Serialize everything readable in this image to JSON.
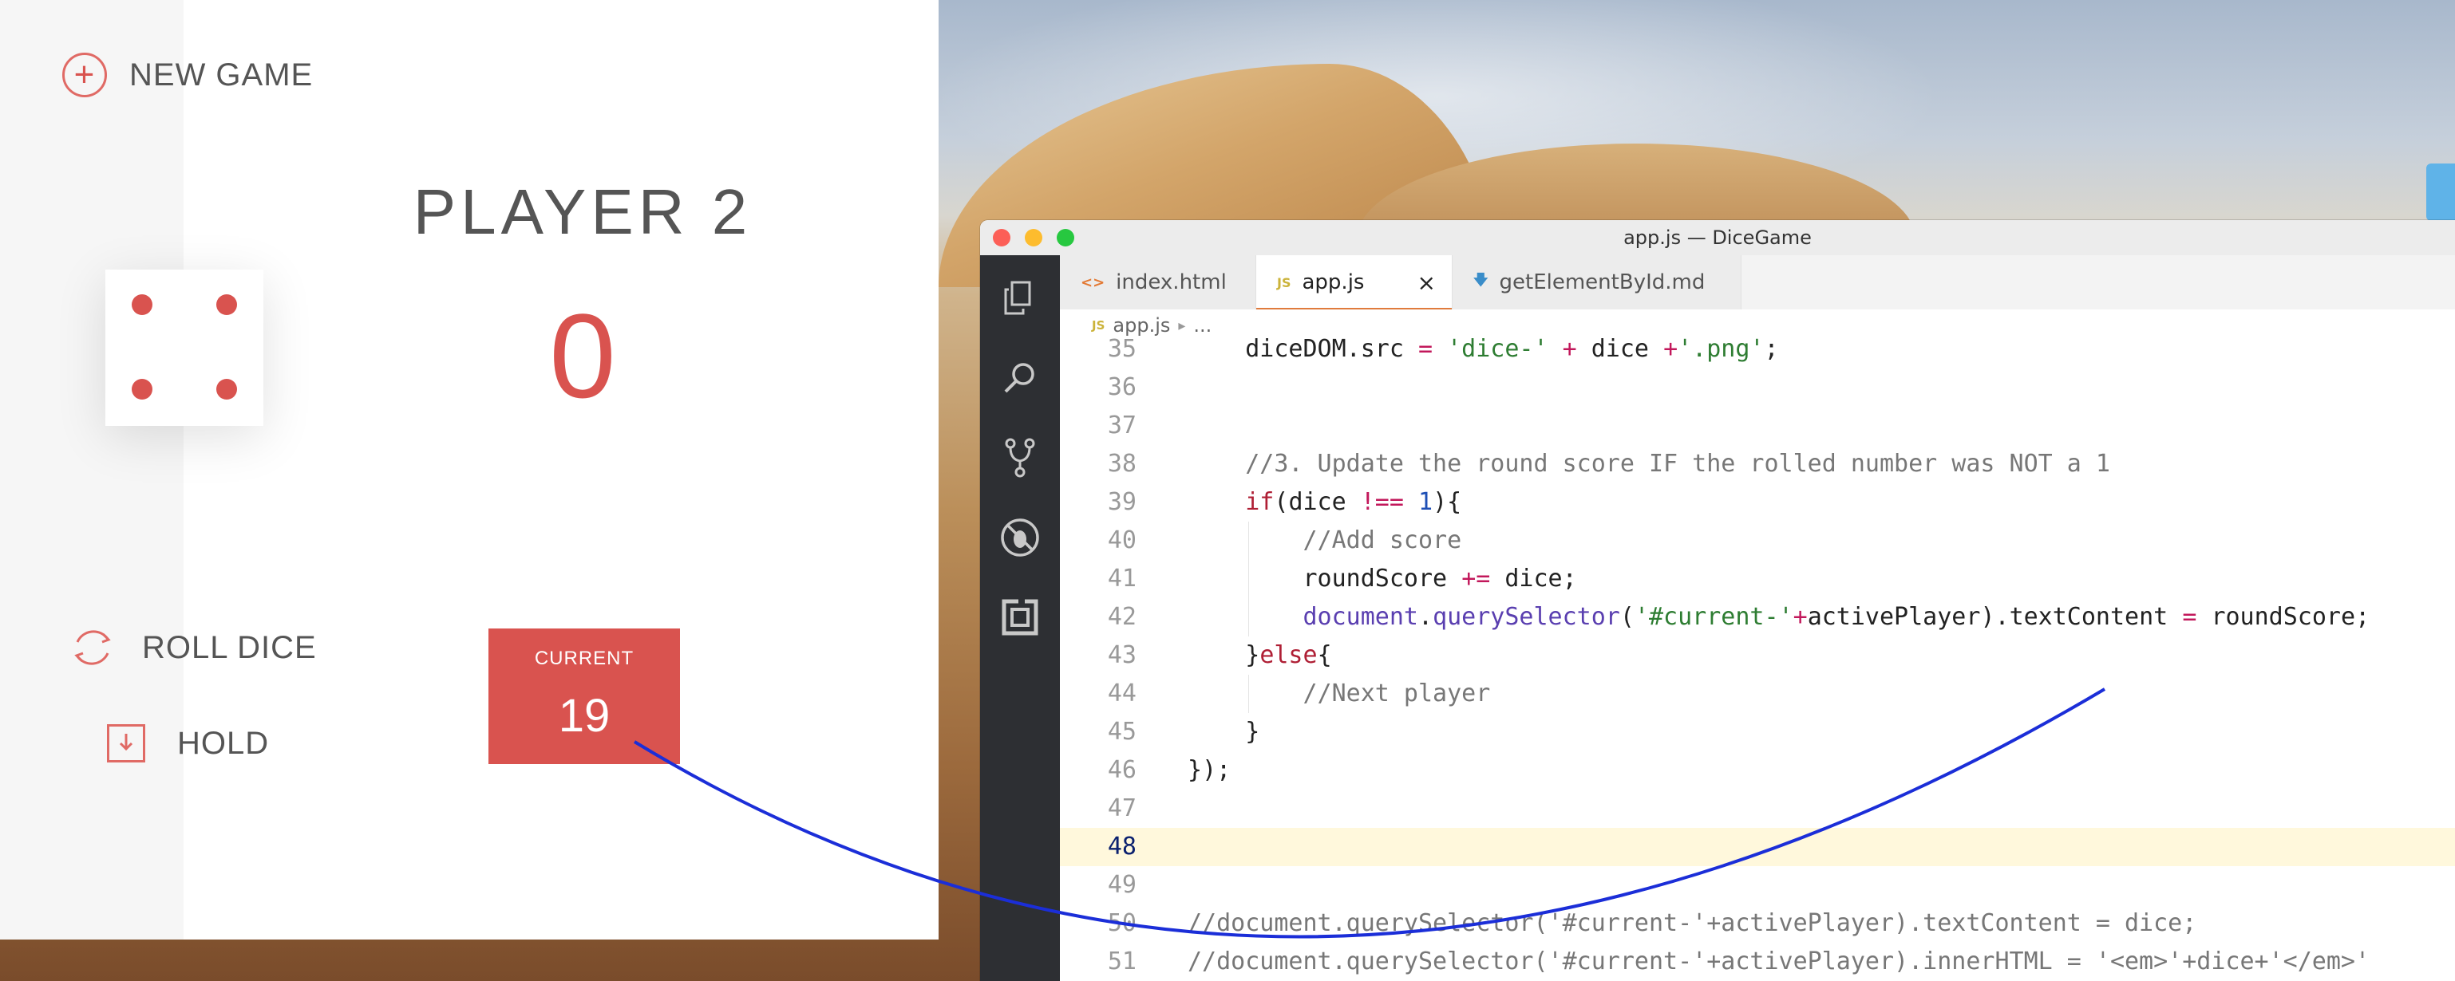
{
  "game": {
    "new_game_label": "NEW GAME",
    "player_name": "PLAYER 2",
    "player_score": "0",
    "dice_value": 4,
    "roll_dice_label": "ROLL DICE",
    "hold_label": "HOLD",
    "current_label": "CURRENT",
    "current_score": "19"
  },
  "editor": {
    "window_title": "app.js — DiceGame",
    "tabs": [
      {
        "icon": "html-file-icon",
        "label": "index.html"
      },
      {
        "icon": "js-file-icon",
        "label": "app.js",
        "active": true,
        "close": "×"
      },
      {
        "icon": "markdown-file-icon",
        "label": "getElementById.md"
      }
    ],
    "breadcrumb": {
      "file": "app.js",
      "rest": "..."
    },
    "activity_icons": [
      "explorer-icon",
      "search-icon",
      "source-control-icon",
      "debug-icon",
      "extensions-icon"
    ],
    "active_line": "48",
    "lines": [
      {
        "num": "35",
        "text": "    diceDOM.src = 'dice-' + dice +'.png';"
      },
      {
        "num": "36",
        "text": ""
      },
      {
        "num": "37",
        "text": ""
      },
      {
        "num": "38",
        "text": "    //3. Update the round score IF the rolled number was NOT a 1"
      },
      {
        "num": "39",
        "text": "    if(dice !== 1){"
      },
      {
        "num": "40",
        "text": "        //Add score"
      },
      {
        "num": "41",
        "text": "        roundScore += dice;"
      },
      {
        "num": "42",
        "text": "        document.querySelector('#current-'+activePlayer).textContent = roundScore;"
      },
      {
        "num": "43",
        "text": "    }else{"
      },
      {
        "num": "44",
        "text": "        //Next player"
      },
      {
        "num": "45",
        "text": "    }"
      },
      {
        "num": "46",
        "text": "});"
      },
      {
        "num": "47",
        "text": ""
      },
      {
        "num": "48",
        "text": ""
      },
      {
        "num": "49",
        "text": ""
      },
      {
        "num": "50",
        "text": "//document.querySelector('#current-'+activePlayer).textContent = dice;"
      },
      {
        "num": "51",
        "text": "//document.querySelector('#current-'+activePlayer).innerHTML = '<em>'+dice+'</em>'"
      }
    ]
  },
  "colors": {
    "game_accent": "#d9534f",
    "editor_sidebar": "#2d2f33",
    "annotation_curve": "#1b2ed8",
    "active_line_highlight": "#fff8dc"
  }
}
